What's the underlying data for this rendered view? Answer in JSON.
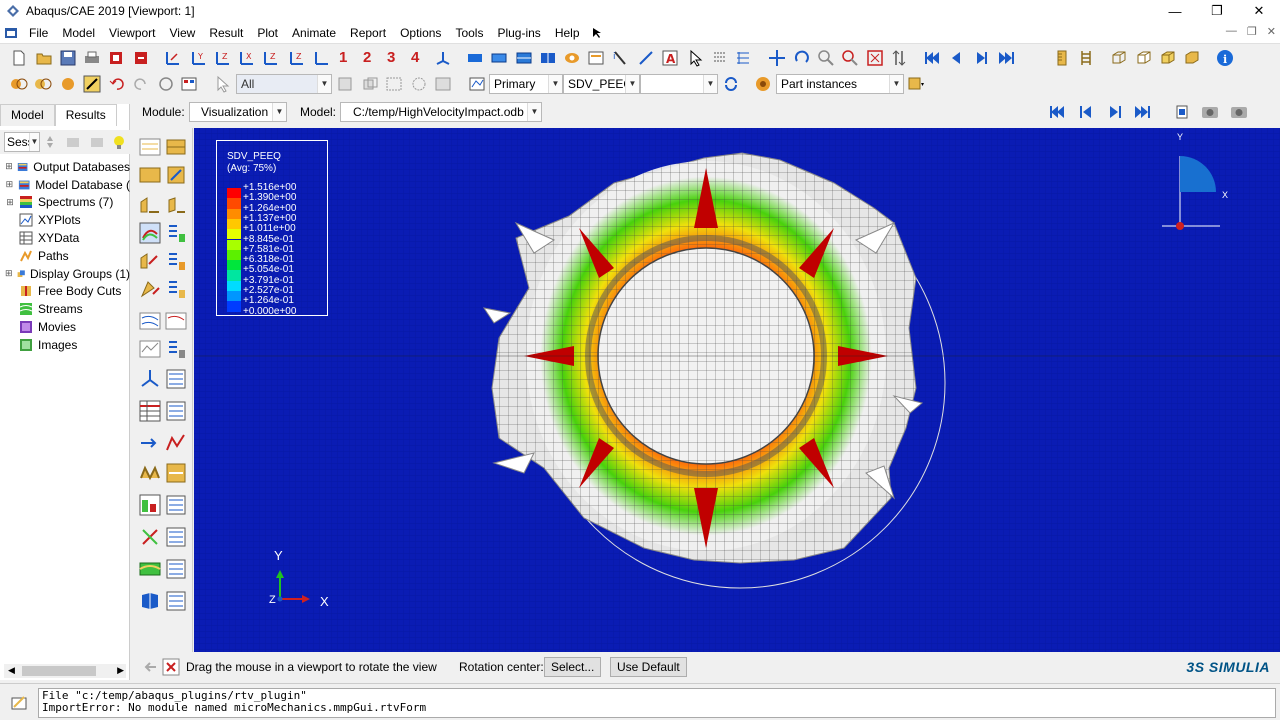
{
  "window": {
    "title": "Abaqus/CAE 2019 [Viewport: 1]"
  },
  "menu": {
    "items": [
      "File",
      "Model",
      "Viewport",
      "View",
      "Result",
      "Plot",
      "Animate",
      "Report",
      "Options",
      "Tools",
      "Plug-ins",
      "Help"
    ]
  },
  "toolbar1": {
    "display_numbers": [
      "1",
      "2",
      "3",
      "4"
    ]
  },
  "toolbar2": {
    "selection_filter": "All",
    "primary": "Primary",
    "variable": "SDV_PEEQ",
    "component": "",
    "instances": "Part instances"
  },
  "module": {
    "module_label": "Module:",
    "module_value": "Visualization",
    "model_label": "Model:",
    "model_value": "C:/temp/HighVelocityImpact.odb"
  },
  "left_panel": {
    "tabs": [
      "Model",
      "Results"
    ],
    "active_tab": "Results",
    "session_combo": "Sess",
    "tree": [
      {
        "label": "Output Databases",
        "expandable": true,
        "icon": "database-icon"
      },
      {
        "label": "Model Database (",
        "expandable": true,
        "icon": "model-db-icon"
      },
      {
        "label": "Spectrums (7)",
        "expandable": true,
        "icon": "spectrum-icon"
      },
      {
        "label": "XYPlots",
        "expandable": false,
        "icon": "xyplot-icon"
      },
      {
        "label": "XYData",
        "expandable": false,
        "icon": "xydata-icon"
      },
      {
        "label": "Paths",
        "expandable": false,
        "icon": "path-icon"
      },
      {
        "label": "Display Groups (1)",
        "expandable": true,
        "icon": "display-group-icon"
      },
      {
        "label": "Free Body Cuts",
        "expandable": false,
        "icon": "free-body-icon"
      },
      {
        "label": "Streams",
        "expandable": false,
        "icon": "stream-icon"
      },
      {
        "label": "Movies",
        "expandable": false,
        "icon": "movie-icon"
      },
      {
        "label": "Images",
        "expandable": false,
        "icon": "image-icon"
      }
    ]
  },
  "legend": {
    "title_line1": "SDV_PEEQ",
    "title_line2": "(Avg: 75%)",
    "values": [
      "+1.516e+00",
      "+1.390e+00",
      "+1.264e+00",
      "+1.137e+00",
      "+1.011e+00",
      "+8.845e-01",
      "+7.581e-01",
      "+6.318e-01",
      "+5.054e-01",
      "+3.791e-01",
      "+2.527e-01",
      "+1.264e-01",
      "+0.000e+00"
    ],
    "colors": [
      "#ff0000",
      "#ff4a00",
      "#ff8c00",
      "#ffc800",
      "#e6ff00",
      "#a8ff00",
      "#5cf000",
      "#00e63c",
      "#00e6a0",
      "#00dcff",
      "#0096ff",
      "#003cff",
      "#0000ff"
    ]
  },
  "triad": {
    "x": "X",
    "y": "Y",
    "z": "Z"
  },
  "small_triad": {
    "x": "X",
    "y": "Y"
  },
  "prompt": {
    "message": "Drag the mouse in a viewport to rotate the view",
    "rotation_center_label": "Rotation center:",
    "select_button": "Select...",
    "default_button": "Use Default"
  },
  "brand": "3S SIMULIA",
  "messages": [
    "File \"c:/temp/abaqus_plugins/rtv_plugin\"",
    "ImportError: No module named microMechanics.mmpGui.rtvForm"
  ],
  "colors": {
    "viewport_bg": "#0a1cb4",
    "accent_red": "#c82020",
    "brand_blue": "#005386"
  }
}
